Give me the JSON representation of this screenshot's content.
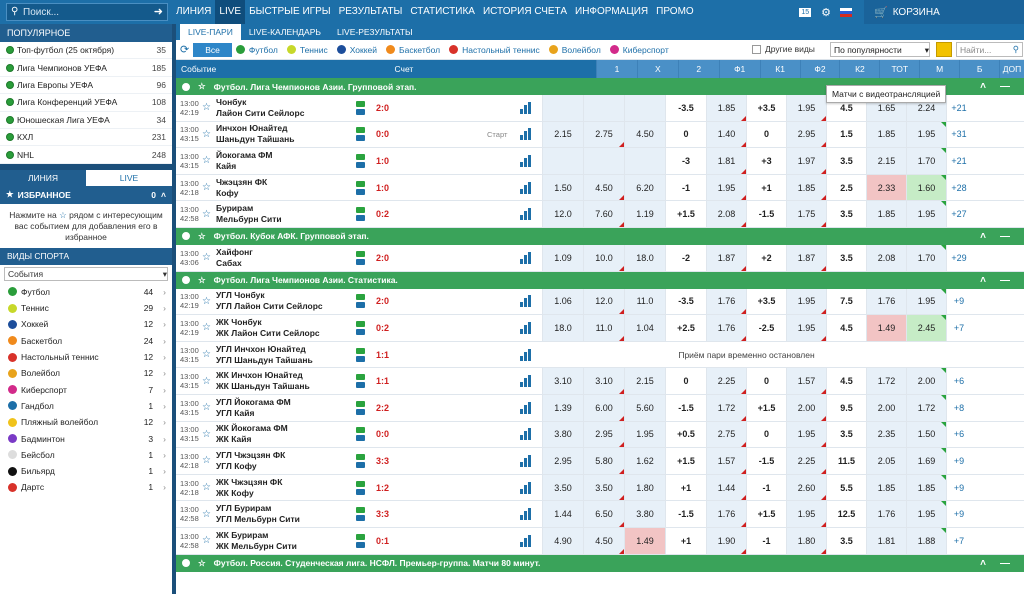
{
  "search": {
    "placeholder": "Поиск..."
  },
  "nav": [
    "ЛИНИЯ",
    "LIVE",
    "БЫСТРЫЕ ИГРЫ",
    "РЕЗУЛЬТАТЫ",
    "СТАТИСТИКА",
    "ИСТОРИЯ СЧЕТА",
    "ИНФОРМАЦИЯ",
    "ПРОМО"
  ],
  "topright": {
    "badge": "15",
    "cart": "КОРЗИНА"
  },
  "sidebar": {
    "popular_title": "ПОПУЛЯРНОЕ",
    "popular": [
      {
        "name": "Топ-футбол (25 октября)",
        "count": "35"
      },
      {
        "name": "Лига Чемпионов УЕФА",
        "count": "185"
      },
      {
        "name": "Лига Европы УЕФА",
        "count": "96"
      },
      {
        "name": "Лига Конференций УЕФА",
        "count": "108"
      },
      {
        "name": "Юношеская Лига УЕФА",
        "count": "34"
      },
      {
        "name": "КХЛ",
        "count": "231"
      },
      {
        "name": "NHL",
        "count": "248"
      }
    ],
    "tab_line": "ЛИНИЯ",
    "tab_live": "LIVE",
    "fav_title": "ИЗБРАННОЕ",
    "fav_count": "0",
    "fav_text1": "Нажмите на",
    "fav_text2": "рядом с интересующим вас событием для добавления его в избранное",
    "sports_title": "ВИДЫ СПОРТА",
    "sort_select": "События",
    "sports": [
      {
        "name": "Футбол",
        "count": "44",
        "color": "#2a9d3a"
      },
      {
        "name": "Теннис",
        "count": "29",
        "color": "#c7d82a"
      },
      {
        "name": "Хоккей",
        "count": "12",
        "color": "#1d4e9b"
      },
      {
        "name": "Баскетбол",
        "count": "24",
        "color": "#f08a1c"
      },
      {
        "name": "Настольный теннис",
        "count": "12",
        "color": "#d8322a"
      },
      {
        "name": "Волейбол",
        "count": "12",
        "color": "#e8a31c"
      },
      {
        "name": "Киберспорт",
        "count": "7",
        "color": "#d22a8a"
      },
      {
        "name": "Гандбол",
        "count": "1",
        "color": "#1d6fa8"
      },
      {
        "name": "Пляжный волейбол",
        "count": "12",
        "color": "#f0c31c"
      },
      {
        "name": "Бадминтон",
        "count": "3",
        "color": "#7a3ac6"
      },
      {
        "name": "Бейсбол",
        "count": "1",
        "color": "#ddd"
      },
      {
        "name": "Бильярд",
        "count": "1",
        "color": "#111"
      },
      {
        "name": "Дартс",
        "count": "1",
        "color": "#d8322a"
      }
    ]
  },
  "main": {
    "tabs": [
      "LIVE-ПАРИ",
      "LIVE-КАЛЕНДАРЬ",
      "LIVE-РЕЗУЛЬТАТЫ"
    ],
    "filter_all": "Все",
    "filters": [
      {
        "name": "Футбол",
        "color": "#2a9d3a"
      },
      {
        "name": "Теннис",
        "color": "#c7d82a"
      },
      {
        "name": "Хоккей",
        "color": "#1d4e9b"
      },
      {
        "name": "Баскетбол",
        "color": "#f08a1c"
      },
      {
        "name": "Настольный теннис",
        "color": "#d8322a"
      },
      {
        "name": "Волейбол",
        "color": "#e8a31c"
      },
      {
        "name": "Киберспорт",
        "color": "#d22a8a"
      }
    ],
    "other": "Другие виды",
    "sort": "По популярности",
    "find": "Найти...",
    "tooltip": "Матчи с видеотрансляцией",
    "headers": {
      "event": "Событие",
      "score": "Счет",
      "cols": [
        "1",
        "X",
        "2",
        "Ф1",
        "К1",
        "Ф2",
        "К2",
        "ТОТ",
        "М",
        "Б",
        "ДОП"
      ]
    },
    "suspended": "Приём пари временно остановлен",
    "sections": [
      {
        "league": "Футбол. Лига Чемпионов Азии. Групповой этап.",
        "rows": [
          {
            "t1": "13:00",
            "t2": "42:19",
            "h": "Чонбук",
            "a": "Лайон Сити Сейлорс",
            "s": "2:0",
            "n": "",
            "o": [
              "",
              "",
              "",
              "-3.5",
              "1.85",
              "+3.5",
              "1.95",
              "4.5",
              "1.65",
              "2.24",
              "+21"
            ]
          },
          {
            "t1": "13:00",
            "t2": "43:15",
            "h": "Инчхон Юнайтед",
            "a": "Шаньдун Тайшань",
            "s": "0:0",
            "n": "Старт",
            "o": [
              "2.15",
              "2.75",
              "4.50",
              "0",
              "1.40",
              "0",
              "2.95",
              "1.5",
              "1.85",
              "1.95",
              "+31"
            ]
          },
          {
            "t1": "13:00",
            "t2": "43:15",
            "h": "Йокогама ФМ",
            "a": "Кайя",
            "s": "1:0",
            "n": "",
            "o": [
              "",
              "",
              "",
              "-3",
              "1.81",
              "+3",
              "1.97",
              "3.5",
              "2.15",
              "1.70",
              "+21"
            ]
          },
          {
            "t1": "13:00",
            "t2": "42:18",
            "h": "Чжэцзян ФК",
            "a": "Кофу",
            "s": "1:0",
            "n": "",
            "o": [
              "1.50",
              "4.50",
              "6.20",
              "-1",
              "1.95",
              "+1",
              "1.85",
              "2.5",
              "2.33",
              "1.60",
              "+28"
            ]
          },
          {
            "t1": "13:00",
            "t2": "42:58",
            "h": "Бурирам",
            "a": "Мельбурн Сити",
            "s": "0:2",
            "n": "",
            "o": [
              "12.0",
              "7.60",
              "1.19",
              "+1.5",
              "2.08",
              "-1.5",
              "1.75",
              "3.5",
              "1.85",
              "1.95",
              "+27"
            ]
          }
        ]
      },
      {
        "league": "Футбол. Кубок АФК. Групповой этап.",
        "rows": [
          {
            "t1": "13:00",
            "t2": "43:06",
            "h": "Хайфонг",
            "a": "Сабах",
            "s": "2:0",
            "n": "",
            "o": [
              "1.09",
              "10.0",
              "18.0",
              "-2",
              "1.87",
              "+2",
              "1.87",
              "3.5",
              "2.08",
              "1.70",
              "+29"
            ]
          }
        ]
      },
      {
        "league": "Футбол. Лига Чемпионов Азии. Статистика.",
        "rows": [
          {
            "t1": "13:00",
            "t2": "42:19",
            "h": "УГЛ Чонбук",
            "a": "УГЛ Лайон Сити Сейлорс",
            "s": "2:0",
            "n": "",
            "o": [
              "1.06",
              "12.0",
              "11.0",
              "-3.5",
              "1.76",
              "+3.5",
              "1.95",
              "7.5",
              "1.76",
              "1.95",
              "+9"
            ]
          },
          {
            "t1": "13:00",
            "t2": "42:19",
            "h": "ЖК Чонбук",
            "a": "ЖК Лайон Сити Сейлорс",
            "s": "0:2",
            "n": "",
            "o": [
              "18.0",
              "11.0",
              "1.04",
              "+2.5",
              "1.76",
              "-2.5",
              "1.95",
              "4.5",
              "1.49",
              "2.45",
              "+7"
            ]
          },
          {
            "t1": "13:00",
            "t2": "43:15",
            "h": "УГЛ Инчхон Юнайтед",
            "a": "УГЛ Шаньдун Тайшань",
            "s": "1:1",
            "n": "",
            "susp": true
          },
          {
            "t1": "13:00",
            "t2": "43:15",
            "h": "ЖК Инчхон Юнайтед",
            "a": "ЖК Шаньдун Тайшань",
            "s": "1:1",
            "n": "",
            "o": [
              "3.10",
              "3.10",
              "2.15",
              "0",
              "2.25",
              "0",
              "1.57",
              "4.5",
              "1.72",
              "2.00",
              "+6"
            ]
          },
          {
            "t1": "13:00",
            "t2": "43:15",
            "h": "УГЛ Йокогама ФМ",
            "a": "УГЛ Кайя",
            "s": "2:2",
            "n": "",
            "o": [
              "1.39",
              "6.00",
              "5.60",
              "-1.5",
              "1.72",
              "+1.5",
              "2.00",
              "9.5",
              "2.00",
              "1.72",
              "+8"
            ]
          },
          {
            "t1": "13:00",
            "t2": "43:15",
            "h": "ЖК Йокогама ФМ",
            "a": "ЖК Кайя",
            "s": "0:0",
            "n": "",
            "o": [
              "3.80",
              "2.95",
              "1.95",
              "+0.5",
              "2.75",
              "0",
              "1.95",
              "3.5",
              "2.35",
              "1.50",
              "+6"
            ]
          },
          {
            "t1": "13:00",
            "t2": "42:18",
            "h": "УГЛ Чжэцзян ФК",
            "a": "УГЛ Кофу",
            "s": "3:3",
            "n": "",
            "o": [
              "2.95",
              "5.80",
              "1.62",
              "+1.5",
              "1.57",
              "-1.5",
              "2.25",
              "11.5",
              "2.05",
              "1.69",
              "+9"
            ]
          },
          {
            "t1": "13:00",
            "t2": "42:18",
            "h": "ЖК Чжэцзян ФК",
            "a": "ЖК Кофу",
            "s": "1:2",
            "n": "",
            "o": [
              "3.50",
              "3.50",
              "1.80",
              "+1",
              "1.44",
              "-1",
              "2.60",
              "5.5",
              "1.85",
              "1.85",
              "+9"
            ]
          },
          {
            "t1": "13:00",
            "t2": "42:58",
            "h": "УГЛ Бурирам",
            "a": "УГЛ Мельбурн Сити",
            "s": "3:3",
            "n": "",
            "o": [
              "1.44",
              "6.50",
              "3.80",
              "-1.5",
              "1.76",
              "+1.5",
              "1.95",
              "12.5",
              "1.76",
              "1.95",
              "+9"
            ]
          },
          {
            "t1": "13:00",
            "t2": "42:58",
            "h": "ЖК Бурирам",
            "a": "ЖК Мельбурн Сити",
            "s": "0:1",
            "n": "",
            "o": [
              "4.90",
              "4.50",
              "1.49",
              "+1",
              "1.90",
              "-1",
              "1.80",
              "3.5",
              "1.81",
              "1.88",
              "+7"
            ]
          }
        ]
      },
      {
        "league": "Футбол. Россия. Студенческая лига. НСФЛ. Премьер-группа. Матчи 80 минут.",
        "rows": []
      }
    ]
  }
}
